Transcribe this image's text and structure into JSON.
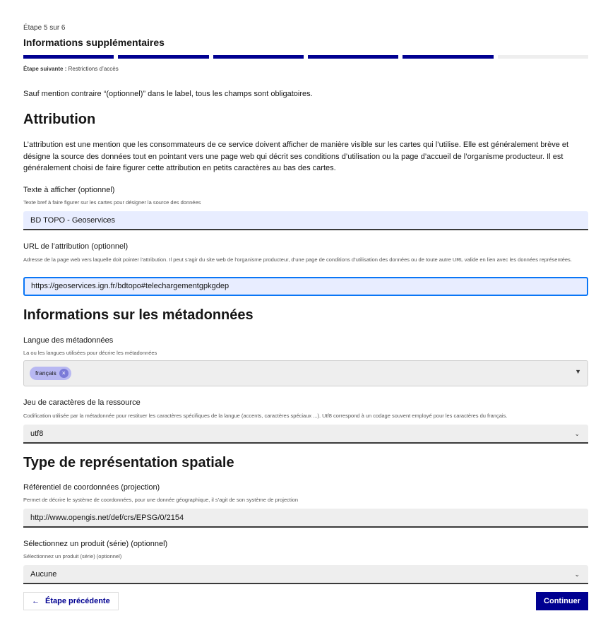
{
  "stepper": {
    "step_count": "Étape 5 sur 6",
    "title": "Informations supplémentaires",
    "total_steps": 6,
    "completed_steps": 5,
    "next_label": "Étape suivante :",
    "next_title": "Restrictions d’accès"
  },
  "mandatory_notice": "Sauf mention contraire “(optionnel)” dans le label, tous les champs sont obligatoires.",
  "attribution": {
    "heading": "Attribution",
    "description": "L’attribution est une mention que les consommateurs de ce service doivent afficher de manière visible sur les cartes qui l’utilise. Elle est généralement brève et désigne la source des données tout en pointant vers une page web qui décrit ses conditions d’utilisation ou la page d’accueil de l’organisme producteur. Il est généralement choisi de faire figurer cette attribution en petits caractères au bas des cartes.",
    "text_label": "Texte à afficher (optionnel)",
    "text_hint": "Texte bref à faire figurer sur les cartes pour désigner la source des données",
    "text_value": "BD TOPO - Geoservices",
    "url_label": "URL de l’attribution (optionnel)",
    "url_hint": "Adresse de la page web vers laquelle doit pointer l’attribution. Il peut s’agir du site web de l’organisme producteur, d’une page de conditions d’utilisation des données ou de toute autre URL valide en lien avec les données représentées.",
    "url_value": "https://geoservices.ign.fr/bdtopo#telechargementgpkgdep"
  },
  "metadata": {
    "heading": "Informations sur les métadonnées",
    "language_label": "Langue des métadonnées",
    "language_hint": "La ou les langues utilisées pour décrire les métadonnées",
    "language_chip": "français",
    "charset_label": "Jeu de caractères de la ressource",
    "charset_hint": "Codification utilisée par la métadonnée pour restituer les caractères spécifiques de la langue (accents, caractères spéciaux ...). Utf8 correspond à un codage souvent employé pour les caractères du français.",
    "charset_value": "utf8"
  },
  "spatial": {
    "heading": "Type de représentation spatiale",
    "crs_label": "Référentiel de coordonnées (projection)",
    "crs_hint": "Permet de décrire le système de coordonnées, pour une donnée géographique, il s’agit de son système de projection",
    "crs_value": "http://www.opengis.net/def/crs/EPSG/0/2154",
    "product_label": "Sélectionnez un produit (série) (optionnel)",
    "product_hint": "Sélectionnez un produit (série) (optionnel)",
    "product_value": "Aucune"
  },
  "actions": {
    "previous_label": "Étape précédente",
    "next_label": "Continuer"
  },
  "icons": {
    "previous": "arrow-left-icon",
    "select": "chevron-down-icon",
    "remove_chip": "close-circle-icon",
    "dropdown": "caret-down-icon"
  },
  "colors": {
    "primary": "#000091",
    "focus": "#0a76f6",
    "chip": "#b8b8f2"
  }
}
